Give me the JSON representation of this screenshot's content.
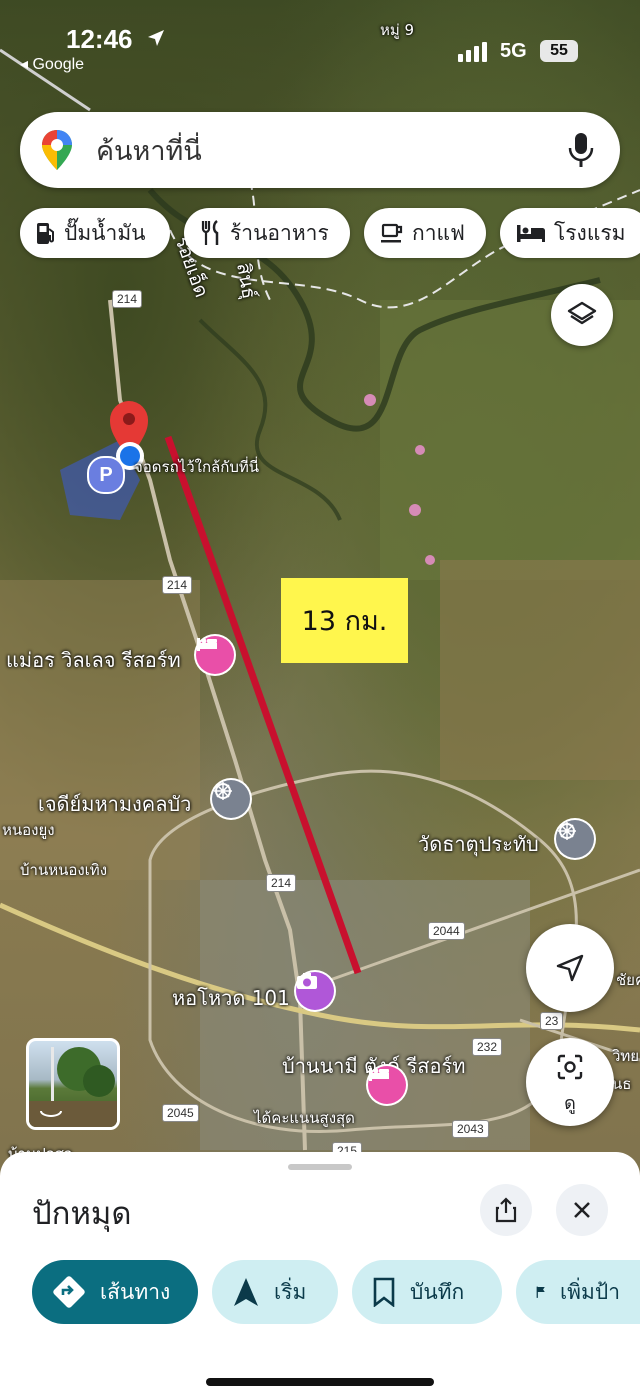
{
  "status_bar": {
    "time": "12:46",
    "back_app": "◂ Google",
    "network": "5G",
    "battery": "55"
  },
  "search": {
    "placeholder": "ค้นหาที่นี่"
  },
  "category_chips": [
    {
      "label": "ปั๊มน้ำมัน",
      "icon": "gas-station-icon"
    },
    {
      "label": "ร้านอาหาร",
      "icon": "restaurant-icon"
    },
    {
      "label": "กาแฟ",
      "icon": "coffee-icon"
    },
    {
      "label": "โรงแรม",
      "icon": "hotel-icon"
    }
  ],
  "map": {
    "top_label": "หมู่ 9",
    "river_labels": [
      "ร้อยเอ็ด",
      "สินธุ์"
    ],
    "parking_label": "จอดรถไว้ใกล้กับที่นี่",
    "distance_label": "13 กม.",
    "roads": [
      "214",
      "214",
      "214",
      "2044",
      "232",
      "23",
      "2045",
      "2043",
      "215"
    ],
    "places": [
      {
        "name": "แม่อร วิลเลจ รีสอร์ท",
        "icon": "hotel-icon"
      },
      {
        "name": "เจดีย์มหามงคลบัว",
        "icon": "temple-icon"
      },
      {
        "name": "วัดธาตุประทับ",
        "icon": "temple-icon"
      },
      {
        "name": "หอโหวด 101",
        "icon": "camera-icon"
      },
      {
        "name": "บ้านนามี ตังค์ รีสอร์ท",
        "subtitle": "ได้คะแนนสูงสุด",
        "icon": "hotel-icon"
      }
    ],
    "small_labels": [
      "หนองยูง",
      "บ้านหนองเทิง",
      "ชัยค",
      "วิทย",
      "นธ",
      "บ้านปอสว"
    ]
  },
  "lens_label": "ดู",
  "sheet": {
    "title": "ปักหมุด",
    "actions": [
      {
        "label": "เส้นทาง",
        "icon": "directions-icon"
      },
      {
        "label": "เริ่ม",
        "icon": "navigation-icon"
      },
      {
        "label": "บันทึก",
        "icon": "bookmark-icon"
      },
      {
        "label": "เพิ่มป้า",
        "icon": "flag-icon"
      }
    ]
  },
  "colors": {
    "pin_red": "#e53935",
    "location_blue": "#1a73e8",
    "route_line": "#c8102e",
    "distance_box": "#fff64d",
    "primary_action": "#0b6e80",
    "secondary_action": "#cfeef2",
    "hotel_pink": "#e94fa8",
    "camera_purple": "#b057d8"
  }
}
